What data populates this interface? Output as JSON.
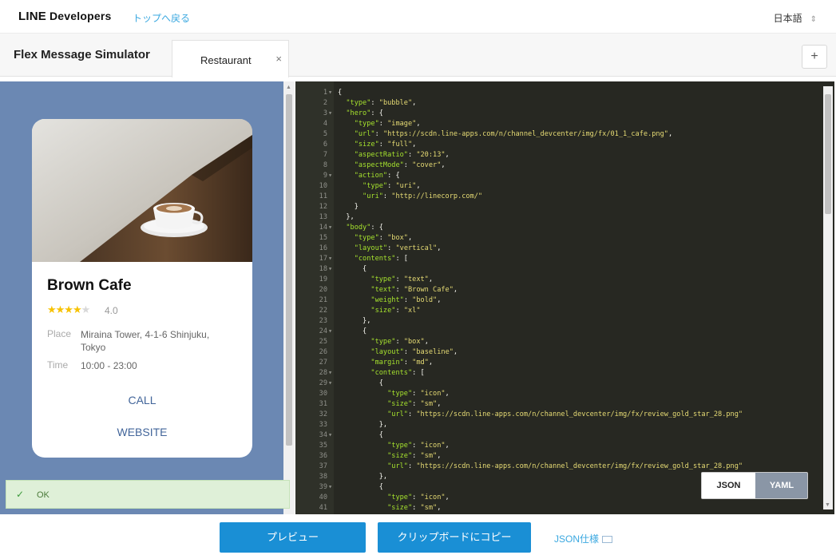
{
  "topbar": {
    "logo_line": "LINE",
    "logo_dev": "Developers",
    "back_link": "トップへ戻る",
    "language": "日本語",
    "language_chevron": "⇕"
  },
  "tabbar": {
    "simulator_title": "Flex Message Simulator",
    "tab_label": "Restaurant",
    "tab_close": "×",
    "add_label": "+"
  },
  "card": {
    "title": "Brown Cafe",
    "stars_filled": "★★★★",
    "stars_empty": "★",
    "rating_value": 4,
    "rating": "4.0",
    "place_label": "Place",
    "place_value": "Miraina Tower, 4-1-6 Shinjuku, Tokyo",
    "time_label": "Time",
    "time_value": "10:00 - 23:00",
    "call_label": "CALL",
    "website_label": "WEBSITE"
  },
  "status": {
    "check": "✓",
    "text": "OK"
  },
  "editor": {
    "lines": [
      {
        "n": "1",
        "f": "▾",
        "t": "{"
      },
      {
        "n": "2",
        "f": "",
        "t": "  \"type\": \"bubble\","
      },
      {
        "n": "3",
        "f": "▾",
        "t": "  \"hero\": {"
      },
      {
        "n": "4",
        "f": "",
        "t": "    \"type\": \"image\","
      },
      {
        "n": "5",
        "f": "",
        "t": "    \"url\": \"https://scdn.line-apps.com/n/channel_devcenter/img/fx/01_1_cafe.png\","
      },
      {
        "n": "6",
        "f": "",
        "t": "    \"size\": \"full\","
      },
      {
        "n": "7",
        "f": "",
        "t": "    \"aspectRatio\": \"20:13\","
      },
      {
        "n": "8",
        "f": "",
        "t": "    \"aspectMode\": \"cover\","
      },
      {
        "n": "9",
        "f": "▾",
        "t": "    \"action\": {"
      },
      {
        "n": "10",
        "f": "",
        "t": "      \"type\": \"uri\","
      },
      {
        "n": "11",
        "f": "",
        "t": "      \"uri\": \"http://linecorp.com/\""
      },
      {
        "n": "12",
        "f": "",
        "t": "    }"
      },
      {
        "n": "13",
        "f": "",
        "t": "  },"
      },
      {
        "n": "14",
        "f": "▾",
        "t": "  \"body\": {"
      },
      {
        "n": "15",
        "f": "",
        "t": "    \"type\": \"box\","
      },
      {
        "n": "16",
        "f": "",
        "t": "    \"layout\": \"vertical\","
      },
      {
        "n": "17",
        "f": "▾",
        "t": "    \"contents\": ["
      },
      {
        "n": "18",
        "f": "▾",
        "t": "      {"
      },
      {
        "n": "19",
        "f": "",
        "t": "        \"type\": \"text\","
      },
      {
        "n": "20",
        "f": "",
        "t": "        \"text\": \"Brown Cafe\","
      },
      {
        "n": "21",
        "f": "",
        "t": "        \"weight\": \"bold\","
      },
      {
        "n": "22",
        "f": "",
        "t": "        \"size\": \"xl\""
      },
      {
        "n": "23",
        "f": "",
        "t": "      },"
      },
      {
        "n": "24",
        "f": "▾",
        "t": "      {"
      },
      {
        "n": "25",
        "f": "",
        "t": "        \"type\": \"box\","
      },
      {
        "n": "26",
        "f": "",
        "t": "        \"layout\": \"baseline\","
      },
      {
        "n": "27",
        "f": "",
        "t": "        \"margin\": \"md\","
      },
      {
        "n": "28",
        "f": "▾",
        "t": "        \"contents\": ["
      },
      {
        "n": "29",
        "f": "▾",
        "t": "          {"
      },
      {
        "n": "30",
        "f": "",
        "t": "            \"type\": \"icon\","
      },
      {
        "n": "31",
        "f": "",
        "t": "            \"size\": \"sm\","
      },
      {
        "n": "32",
        "f": "",
        "t": "            \"url\": \"https://scdn.line-apps.com/n/channel_devcenter/img/fx/review_gold_star_28.png\""
      },
      {
        "n": "33",
        "f": "",
        "t": "          },"
      },
      {
        "n": "34",
        "f": "▾",
        "t": "          {"
      },
      {
        "n": "35",
        "f": "",
        "t": "            \"type\": \"icon\","
      },
      {
        "n": "36",
        "f": "",
        "t": "            \"size\": \"sm\","
      },
      {
        "n": "37",
        "f": "",
        "t": "            \"url\": \"https://scdn.line-apps.com/n/channel_devcenter/img/fx/review_gold_star_28.png\""
      },
      {
        "n": "38",
        "f": "",
        "t": "          },"
      },
      {
        "n": "39",
        "f": "▾",
        "t": "          {"
      },
      {
        "n": "40",
        "f": "",
        "t": "            \"type\": \"icon\","
      },
      {
        "n": "41",
        "f": "",
        "t": "            \"size\": \"sm\","
      }
    ]
  },
  "toggle": {
    "json_label": "JSON",
    "yaml_label": "YAML",
    "active": "YAML"
  },
  "bottom": {
    "preview_label": "プレビュー",
    "copy_label": "クリップボードにコピー",
    "spec_label": "JSON仕様"
  },
  "colors": {
    "accent": "#1a8fd5",
    "preview_bg": "#6b88b3",
    "editor_bg": "#272822",
    "link": "#3aa8e0",
    "card_link": "#42659a",
    "star": "#f7c200"
  }
}
